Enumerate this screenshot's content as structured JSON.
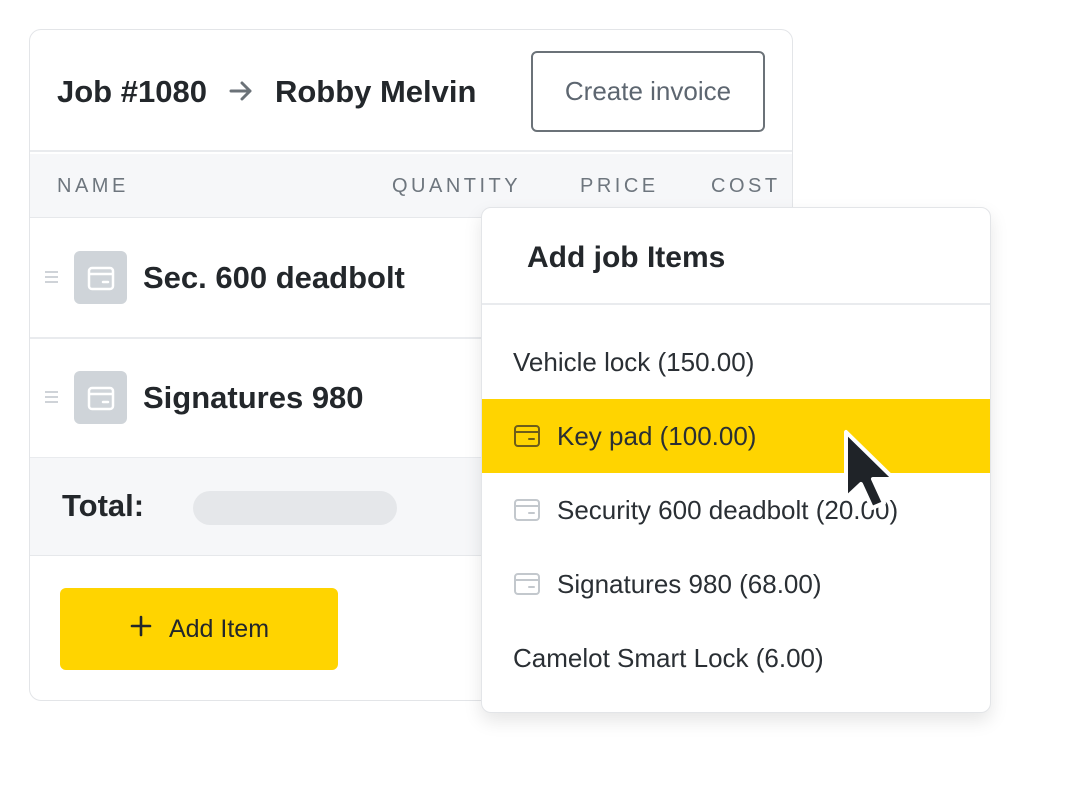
{
  "header": {
    "job": "Job #1080",
    "customer": "Robby Melvin",
    "create_invoice_label": "Create invoice"
  },
  "table": {
    "columns": [
      "NAME",
      "QUANTITY",
      "PRICE",
      "COST"
    ],
    "rows": [
      {
        "name": "Sec. 600 deadbolt",
        "icon": "package-icon"
      },
      {
        "name": "Signatures 980",
        "icon": "package-icon"
      }
    ],
    "total_label": "Total:"
  },
  "add_item": {
    "label": "Add Item",
    "icon": "plus-icon"
  },
  "dropdown": {
    "title": "Add job Items",
    "items": [
      {
        "label": "Vehicle lock (150.00)",
        "icon": null,
        "highlighted": false
      },
      {
        "label": "Key pad (100.00)",
        "icon": "package-icon",
        "highlighted": true
      },
      {
        "label": "Security 600 deadbolt (20.00)",
        "icon": "package-icon",
        "highlighted": false
      },
      {
        "label": "Signatures 980 (68.00)",
        "icon": "package-icon",
        "highlighted": false
      },
      {
        "label": "Camelot Smart Lock (6.00)",
        "icon": null,
        "highlighted": false
      }
    ]
  },
  "colors": {
    "accent": "#ffd400",
    "text": "#23272b",
    "muted": "#6e767e",
    "border": "#e3e5e8"
  }
}
